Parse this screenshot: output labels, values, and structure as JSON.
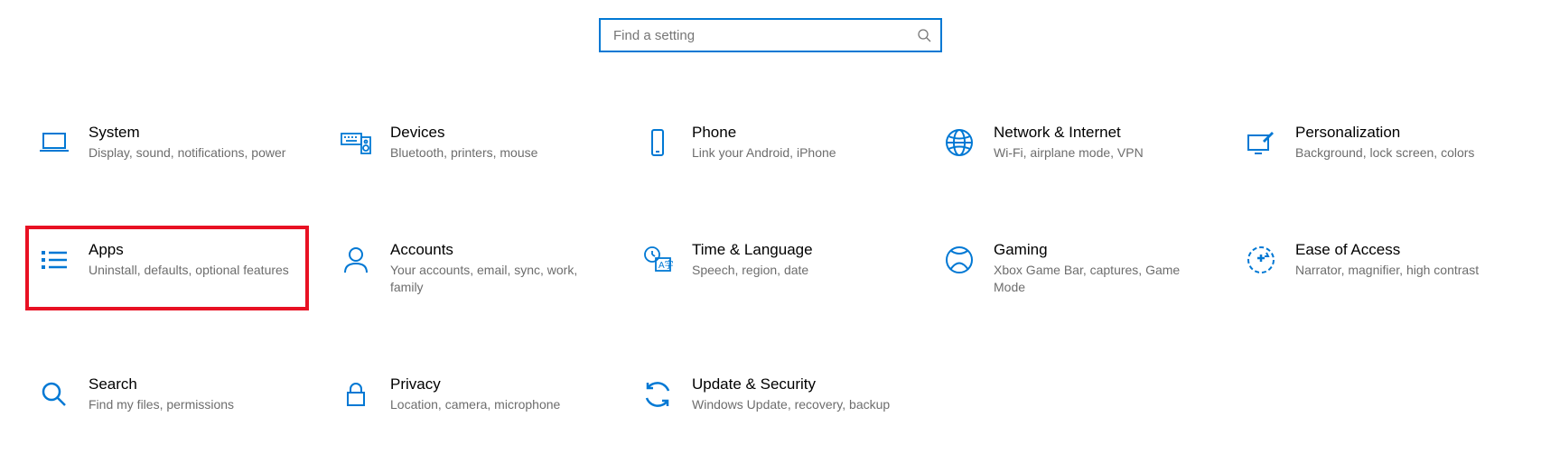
{
  "search": {
    "placeholder": "Find a setting",
    "value": ""
  },
  "tiles": [
    {
      "id": "system",
      "title": "System",
      "desc": "Display, sound, notifications, power"
    },
    {
      "id": "devices",
      "title": "Devices",
      "desc": "Bluetooth, printers, mouse"
    },
    {
      "id": "phone",
      "title": "Phone",
      "desc": "Link your Android, iPhone"
    },
    {
      "id": "network",
      "title": "Network & Internet",
      "desc": "Wi-Fi, airplane mode, VPN"
    },
    {
      "id": "personalization",
      "title": "Personalization",
      "desc": "Background, lock screen, colors"
    },
    {
      "id": "apps",
      "title": "Apps",
      "desc": "Uninstall, defaults, optional features"
    },
    {
      "id": "accounts",
      "title": "Accounts",
      "desc": "Your accounts, email, sync, work, family"
    },
    {
      "id": "time-language",
      "title": "Time & Language",
      "desc": "Speech, region, date"
    },
    {
      "id": "gaming",
      "title": "Gaming",
      "desc": "Xbox Game Bar, captures, Game Mode"
    },
    {
      "id": "ease-of-access",
      "title": "Ease of Access",
      "desc": "Narrator, magnifier, high contrast"
    },
    {
      "id": "search",
      "title": "Search",
      "desc": "Find my files, permissions"
    },
    {
      "id": "privacy",
      "title": "Privacy",
      "desc": "Location, camera, microphone"
    },
    {
      "id": "update-security",
      "title": "Update & Security",
      "desc": "Windows Update, recovery, backup"
    }
  ],
  "highlighted_tile": "apps",
  "colors": {
    "accent": "#0078d4",
    "highlight_border": "#e81123",
    "desc_text": "#6d6d6d"
  }
}
